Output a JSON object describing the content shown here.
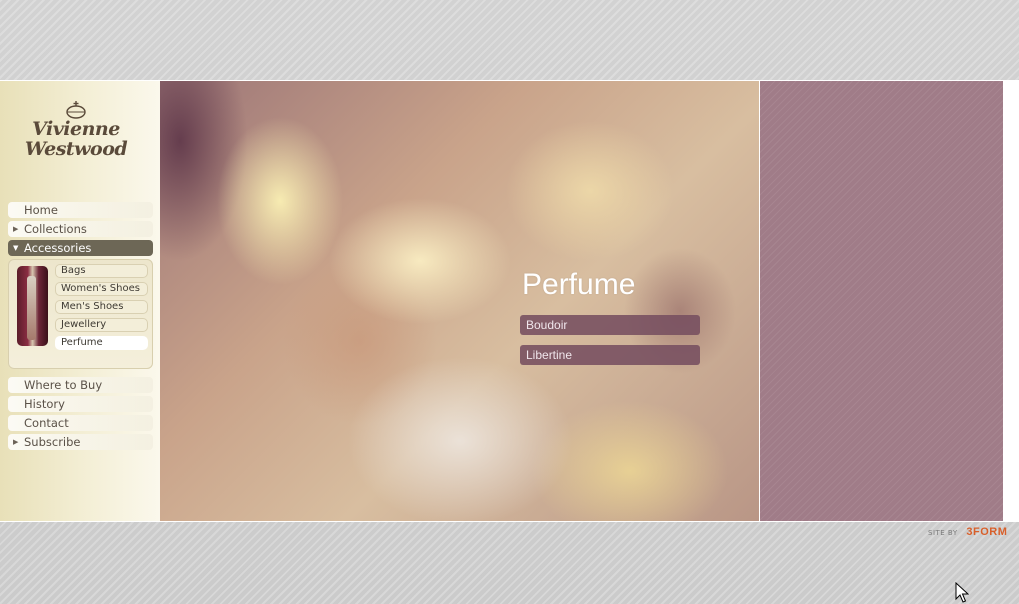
{
  "brand": {
    "line1": "Vivienne",
    "line2": "Westwood"
  },
  "nav": {
    "primary": [
      {
        "label": "Home",
        "arrow": ""
      },
      {
        "label": "Collections",
        "arrow": "▶"
      },
      {
        "label": "Accessories",
        "arrow": "▼"
      }
    ],
    "accessories": [
      {
        "label": "Bags"
      },
      {
        "label": "Women's Shoes"
      },
      {
        "label": "Men's Shoes"
      },
      {
        "label": "Jewellery"
      },
      {
        "label": "Perfume"
      }
    ],
    "secondary": [
      {
        "label": "Where to Buy",
        "arrow": ""
      },
      {
        "label": "History",
        "arrow": ""
      },
      {
        "label": "Contact",
        "arrow": ""
      },
      {
        "label": "Subscribe",
        "arrow": "▶"
      }
    ]
  },
  "hero": {
    "title": "Perfume",
    "buttons": [
      {
        "label": "Boudoir"
      },
      {
        "label": "Libertine"
      }
    ]
  },
  "credit": {
    "prefix": "SITE BY",
    "brand": "3FORM"
  },
  "colors": {
    "nav_active": "#6d6756",
    "hero_button": "#764e60",
    "right_panel": "#a07c88",
    "credit_brand": "#d85f2a"
  }
}
